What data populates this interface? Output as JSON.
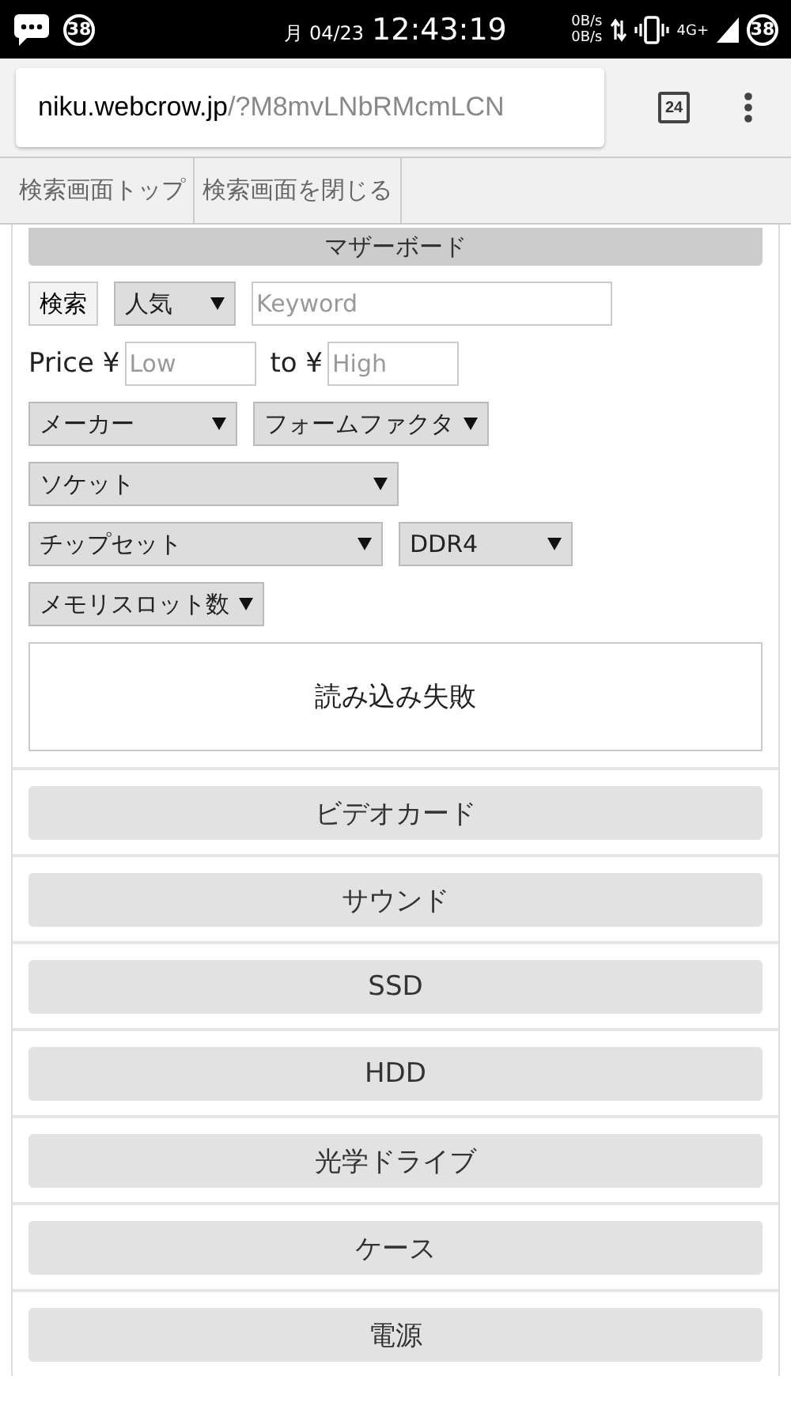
{
  "status_bar": {
    "notification_count": "38",
    "day": "月",
    "date": "04/23",
    "time": "12:43:19",
    "upload_rate": "0B/s",
    "download_rate": "0B/s",
    "network": "4G+",
    "battery": "38"
  },
  "address_bar": {
    "domain": "niku.webcrow.jp",
    "path": "/?M8mvLNbRMcmLCN",
    "tab_count": "24"
  },
  "top_buttons": [
    "検索画面トップ",
    "検索画面を閉じる"
  ],
  "panel": {
    "title": "マザーボード",
    "search_button": "検索",
    "sort": "人気",
    "keyword": {
      "placeholder": "Keyword"
    },
    "price_label": "Price ¥",
    "price_low": {
      "placeholder": "Low"
    },
    "price_to": "to ¥",
    "price_high": {
      "placeholder": "High"
    },
    "filters": [
      [
        {
          "label": "メーカー"
        },
        {
          "label": "フォームファクタ"
        }
      ],
      [
        {
          "label": "ソケット"
        }
      ],
      [
        {
          "label": "チップセット"
        },
        {
          "label": "DDR4"
        }
      ],
      [
        {
          "label": "メモリスロット数"
        }
      ]
    ],
    "message": "読み込み失敗"
  },
  "categories": [
    "ビデオカード",
    "サウンド",
    "SSD",
    "HDD",
    "光学ドライブ",
    "ケース",
    "電源"
  ]
}
